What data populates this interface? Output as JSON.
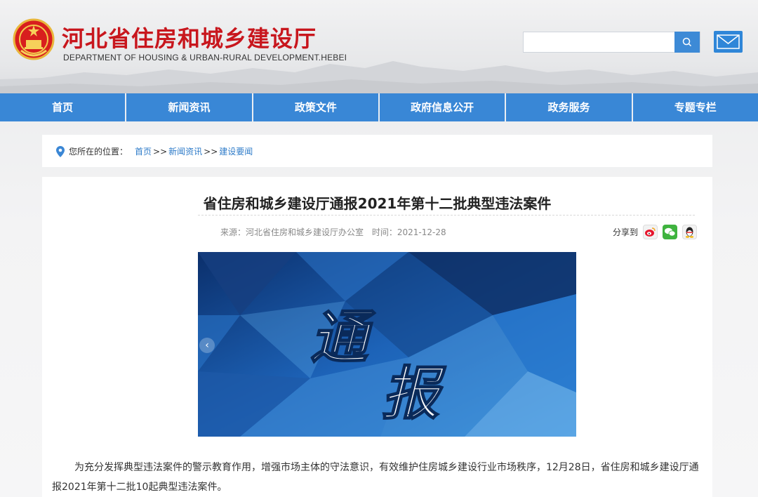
{
  "header": {
    "title_cn": "河北省住房和城乡建设厅",
    "title_en": "DEPARTMENT OF HOUSING & URBAN-RURAL DEVELOPMENT.HEBEI",
    "search": {
      "placeholder": "",
      "value": ""
    },
    "icons": {
      "search": "search-icon",
      "mail": "mail-icon",
      "emblem": "national-emblem"
    }
  },
  "nav": {
    "items": [
      "首页",
      "新闻资讯",
      "政策文件",
      "政府信息公开",
      "政务服务",
      "专题专栏"
    ]
  },
  "breadcrumb": {
    "label": "您所在的位置：",
    "items": [
      "首页",
      "新闻资讯",
      "建设要闻"
    ],
    "separator": ">>"
  },
  "article": {
    "title": "省住房和城乡建设厅通报2021年第十二批典型违法案件",
    "source": "来源：河北省住房和城乡建设厅办公室",
    "time": "时间：2021-12-28",
    "share_label": "分享到",
    "share_icons": [
      "weibo-icon",
      "wechat-icon",
      "qq-icon"
    ],
    "banner_text": "通报",
    "body": "为充分发挥典型违法案件的警示教育作用，增强市场主体的守法意识，有效维护住房城乡建设行业市场秩序，12月28日，省住房和城乡建设厅通报2021年第十二批10起典型违法案件。"
  },
  "colors": {
    "brand_red": "#c8161d",
    "nav_blue": "#3987d6",
    "link_blue": "#2f7cc9"
  }
}
